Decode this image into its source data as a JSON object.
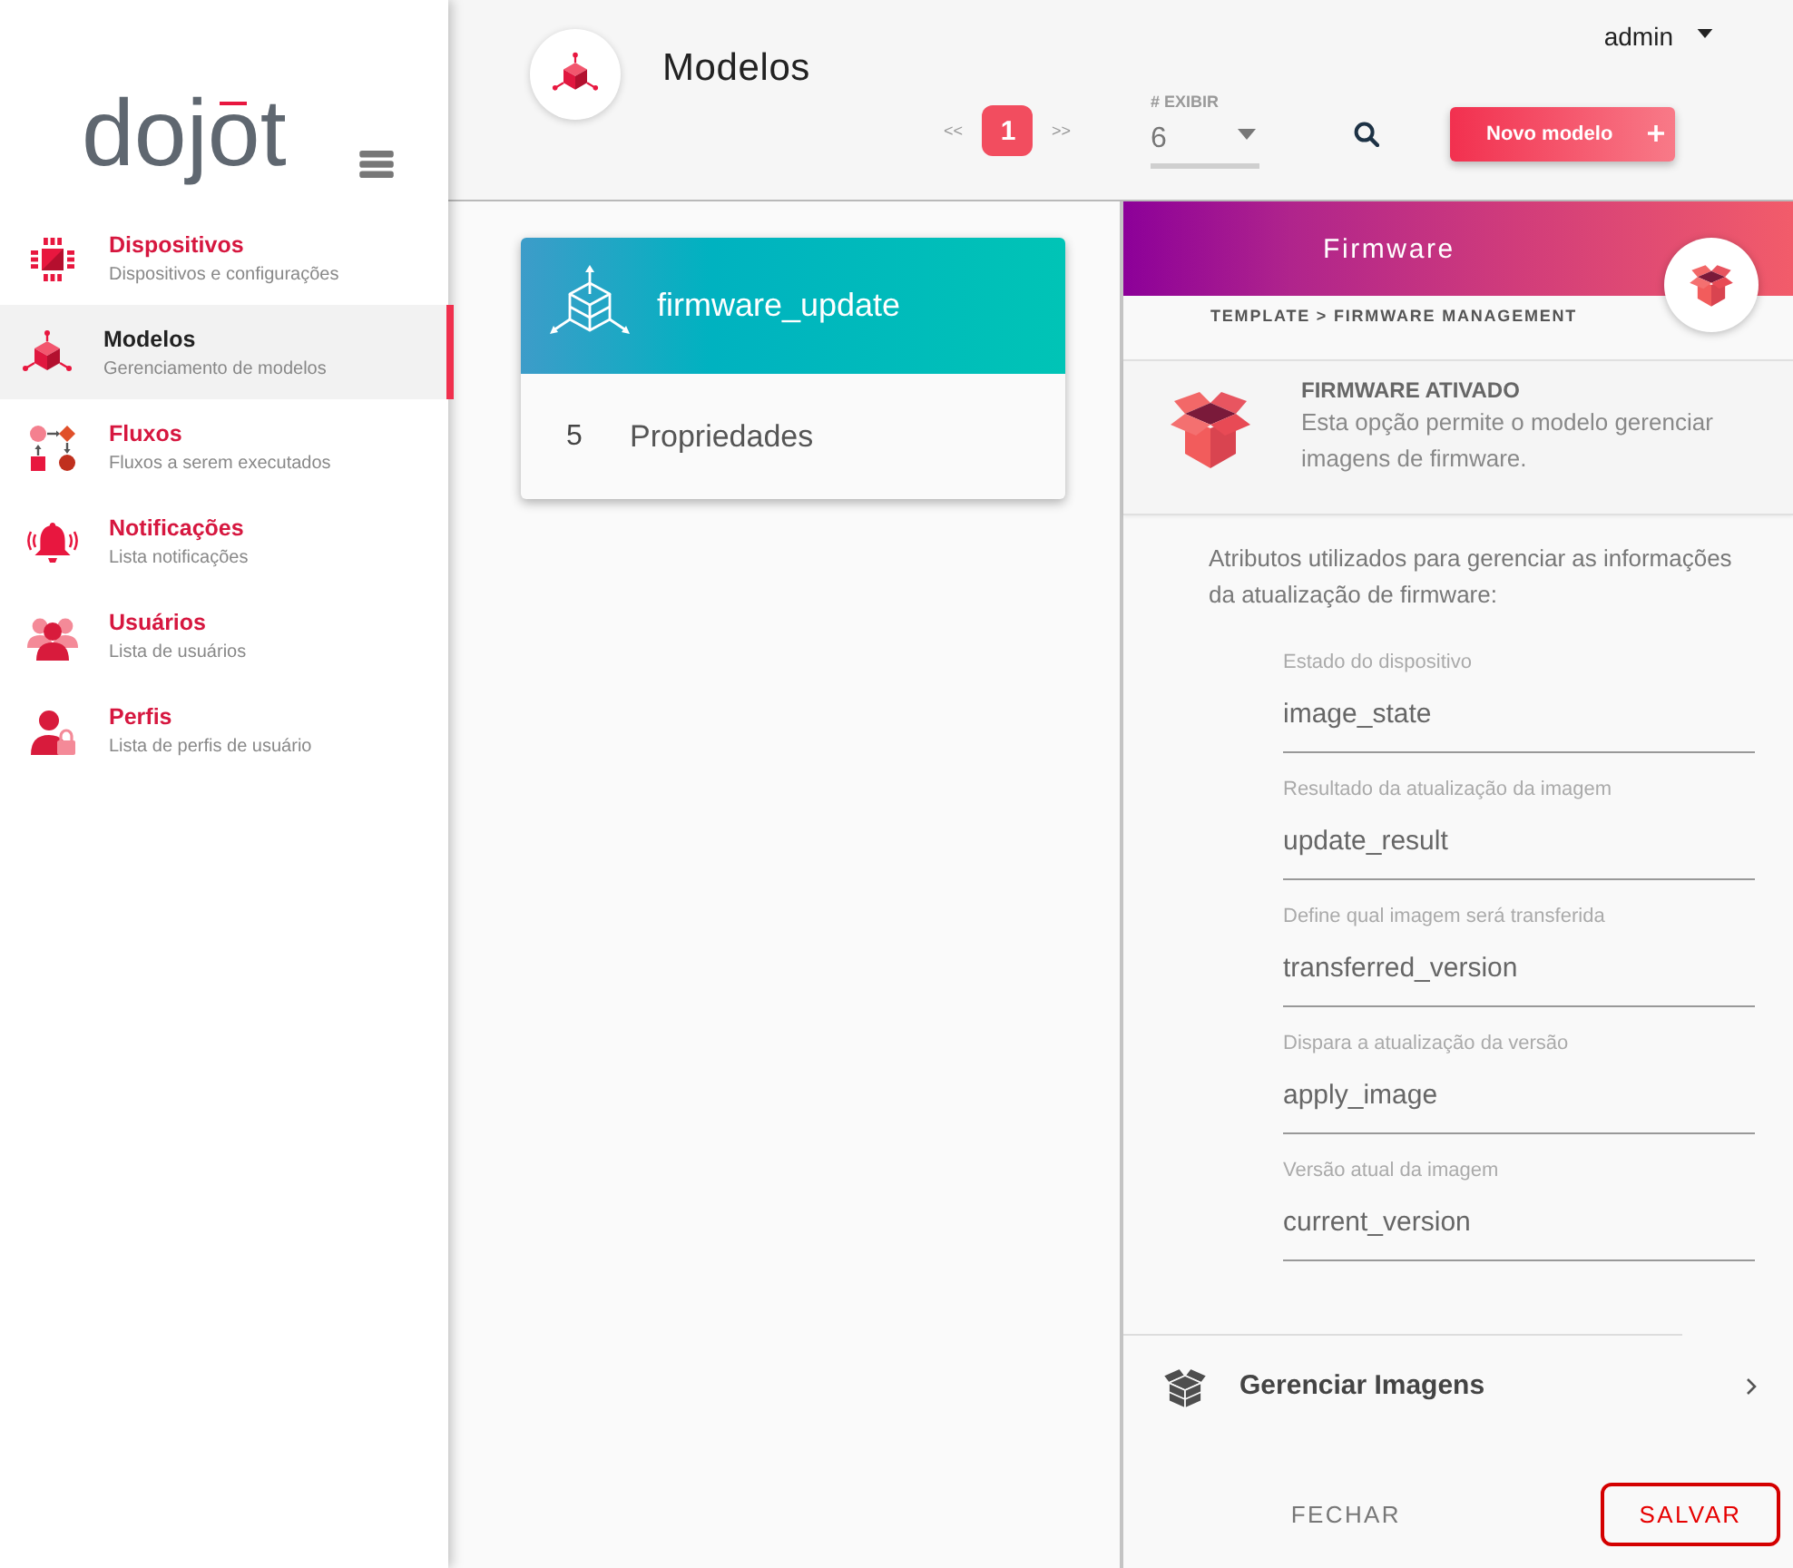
{
  "sidebar": {
    "logo": "dojot",
    "items": [
      {
        "title": "Dispositivos",
        "subtitle": "Dispositivos e configurações",
        "selected": false
      },
      {
        "title": "Modelos",
        "subtitle": "Gerenciamento de modelos",
        "selected": true
      },
      {
        "title": "Fluxos",
        "subtitle": "Fluxos a serem executados",
        "selected": false
      },
      {
        "title": "Notificações",
        "subtitle": "Lista notificações",
        "selected": false
      },
      {
        "title": "Usuários",
        "subtitle": "Lista de usuários",
        "selected": false
      },
      {
        "title": "Perfis",
        "subtitle": "Lista de perfis de usuário",
        "selected": false
      }
    ]
  },
  "header": {
    "title": "Modelos",
    "user": "admin",
    "pagination": {
      "previous": "<<",
      "pages": [
        {
          "label": "1",
          "selected": true
        }
      ],
      "next": ">>"
    },
    "page_size": {
      "label": "# EXIBIR",
      "value": "6"
    },
    "new_button": "Novo modelo"
  },
  "templates": [
    {
      "name": "firmware_update",
      "property_count": "5",
      "property_label": "Propriedades"
    }
  ],
  "panel": {
    "title": "Firmware",
    "breadcrumb": "TEMPLATE > FIRMWARE MANAGEMENT",
    "feature": {
      "title": "FIRMWARE ATIVADO",
      "description": "Esta opção permite o modelo gerenciar imagens de firmware."
    },
    "intro": "Atributos utilizados para gerenciar as informações da atualização de firmware:",
    "fields": [
      {
        "label": "Estado do dispositivo",
        "value": "image_state"
      },
      {
        "label": "Resultado da atualização da imagem",
        "value": "update_result"
      },
      {
        "label": "Define qual imagem será transferida",
        "value": "transferred_version"
      },
      {
        "label": "Dispara a atualização da versão",
        "value": "apply_image"
      },
      {
        "label": "Versão atual da imagem",
        "value": "current_version"
      }
    ],
    "manage_item": "Gerenciar Imagens",
    "buttons": [
      {
        "label": "FECHAR",
        "kind": "text"
      },
      {
        "label": "SALVAR",
        "kind": "outlined"
      }
    ]
  }
}
